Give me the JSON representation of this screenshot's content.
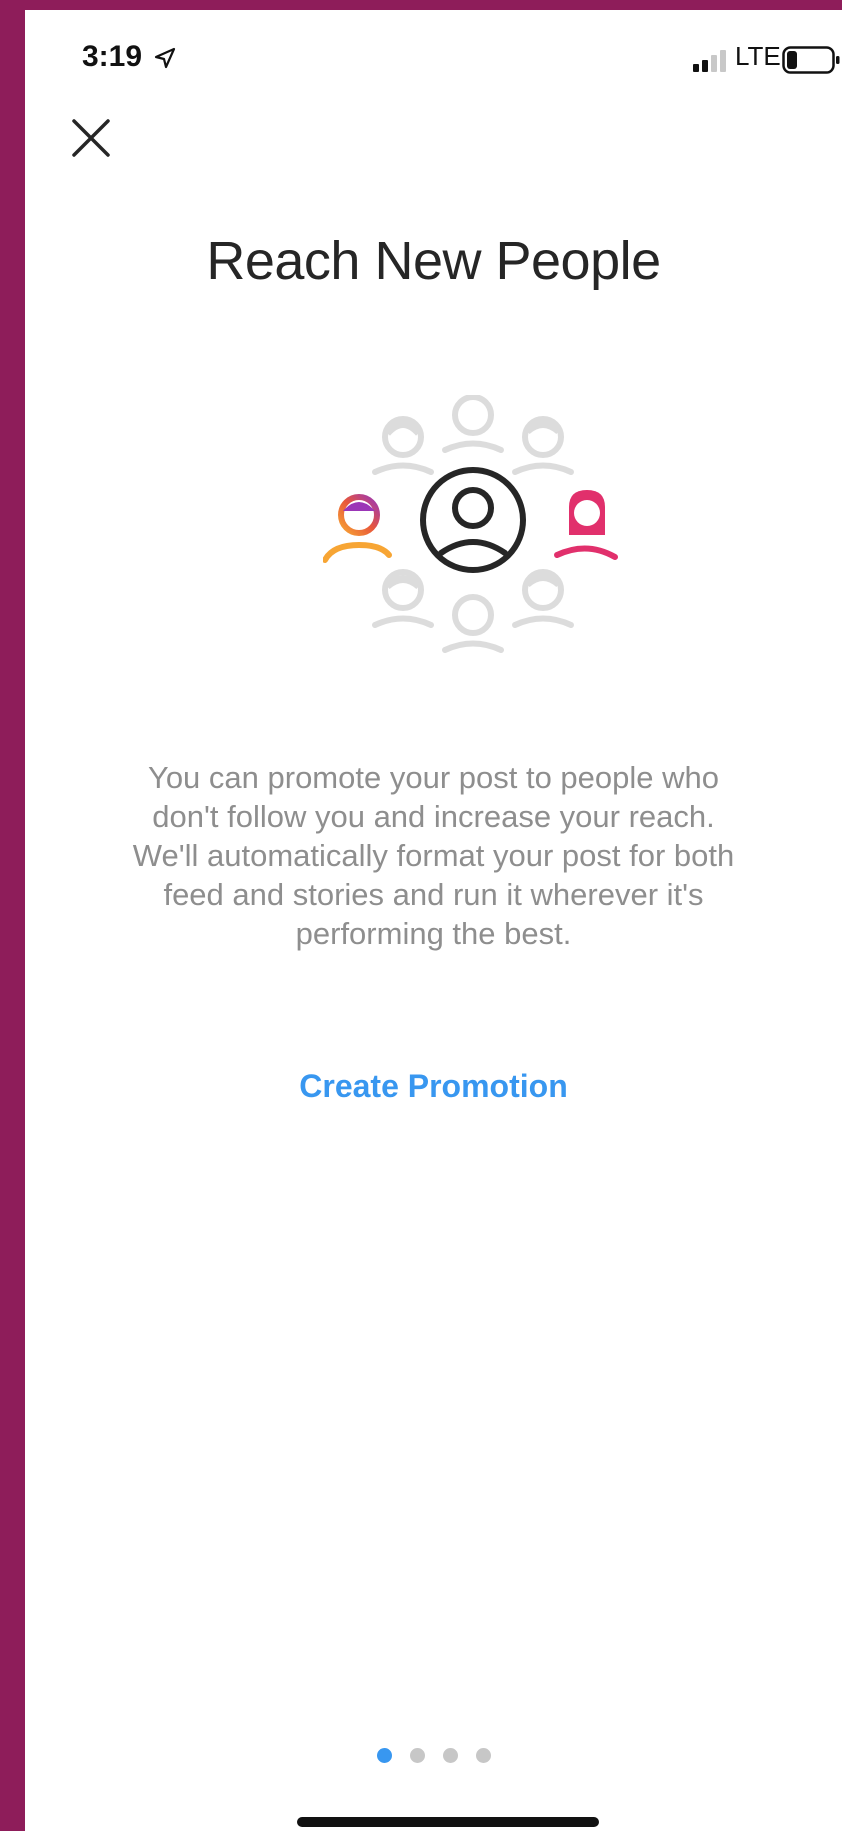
{
  "status_bar": {
    "time": "3:19",
    "carrier": "LTE",
    "signal_bars_active": 2,
    "signal_bars_total": 4
  },
  "header": {
    "close_icon": "close-icon"
  },
  "page": {
    "title": "Reach New People",
    "description": "You can promote your post to people who don't follow you and increase your reach. We'll automatically format your post for both feed and stories and run it wherever it's performing the best.",
    "cta_label": "Create Promotion"
  },
  "pagination": {
    "total": 4,
    "active_index": 0
  },
  "colors": {
    "cta": "#3897f0",
    "dot_active": "#3897f0",
    "dot_inactive": "#c7c7c7",
    "frame": "#8e1d5a"
  }
}
